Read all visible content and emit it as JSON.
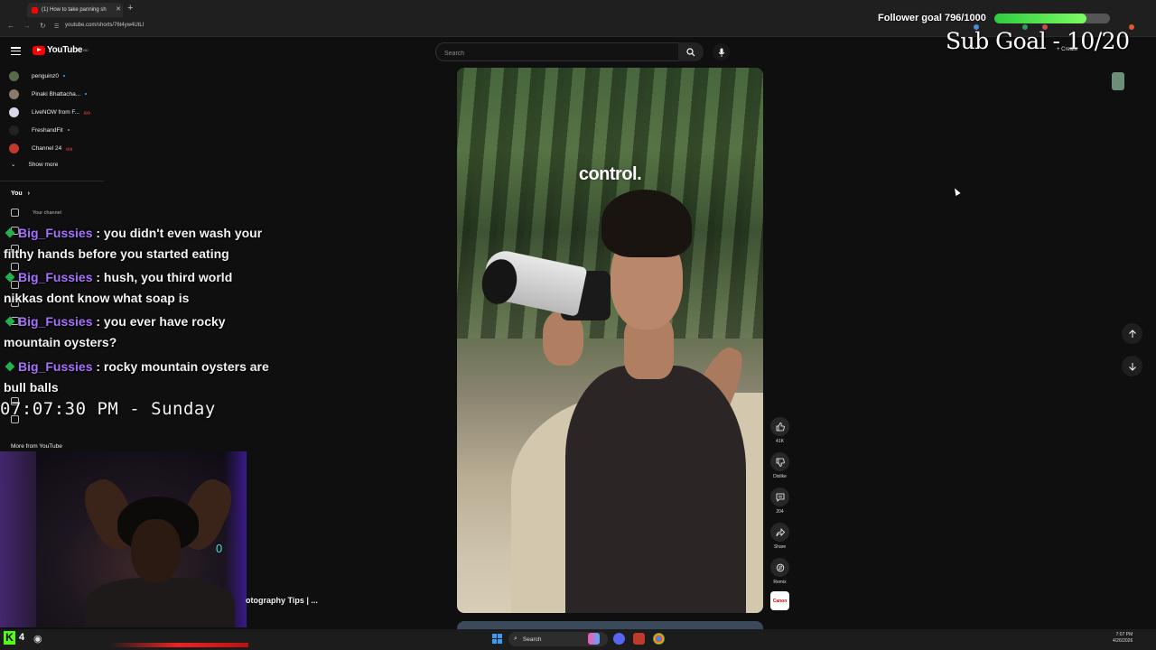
{
  "browser": {
    "tab_title": "(1) How to take panning sh",
    "tab_close": "✕",
    "new_tab": "+",
    "url": "youtube.com/shorts/76t4yw4UtLI"
  },
  "youtube": {
    "logo_text": "YouTube",
    "logo_region": "BD",
    "search_placeholder": "Search",
    "create_label": "+ Create",
    "subscriptions": [
      {
        "name": "penguinz0",
        "status": "dot"
      },
      {
        "name": "Pinaki Bhattacha...",
        "status": "dot"
      },
      {
        "name": "LiveNOW from F...",
        "status": "live"
      },
      {
        "name": "FreshandFit",
        "status": "dot"
      },
      {
        "name": "Channel 24",
        "status": "live"
      }
    ],
    "show_more": "Show more",
    "you_header": "You",
    "you_items": [
      "Your channel"
    ],
    "more_from": "More from YouTube",
    "video_caption": "control.",
    "video_title_fragment": "otography Tips | ...",
    "actions": {
      "like_count": "41K",
      "dislike_label": "Dislike",
      "comments_count": "204",
      "share_label": "Share",
      "remix_label": "Remix",
      "channel_avatar_text": "Canon"
    }
  },
  "chat": [
    {
      "user": "Big_Fussies",
      "message": ": you didn't even wash your filthy hands before you started eating"
    },
    {
      "user": "Big_Fussies",
      "message": ": hush, you third world nikkas dont know what soap is"
    },
    {
      "user": "Big_Fussies",
      "message": ": you ever have rocky mountain oysters?"
    },
    {
      "user": "Big_Fussies",
      "message": ": rocky mountain oysters are bull balls"
    }
  ],
  "stream": {
    "clock": "07:07:30 PM - Sunday",
    "follower_goal": "Follower goal 796/1000",
    "follower_progress": 0.796,
    "sub_goal": "Sub Goal - 10/20",
    "webcam_counter": "0",
    "viewer_count": "4",
    "platform_logo": "K"
  },
  "taskbar": {
    "search_label": "Search",
    "time": "7:07 PM",
    "date": "4/26/2026"
  },
  "colors": {
    "accent_red": "#ff0000",
    "chat_username": "#a970ff",
    "follower_bar": "#2ecc40",
    "kick_green": "#53fc18"
  }
}
